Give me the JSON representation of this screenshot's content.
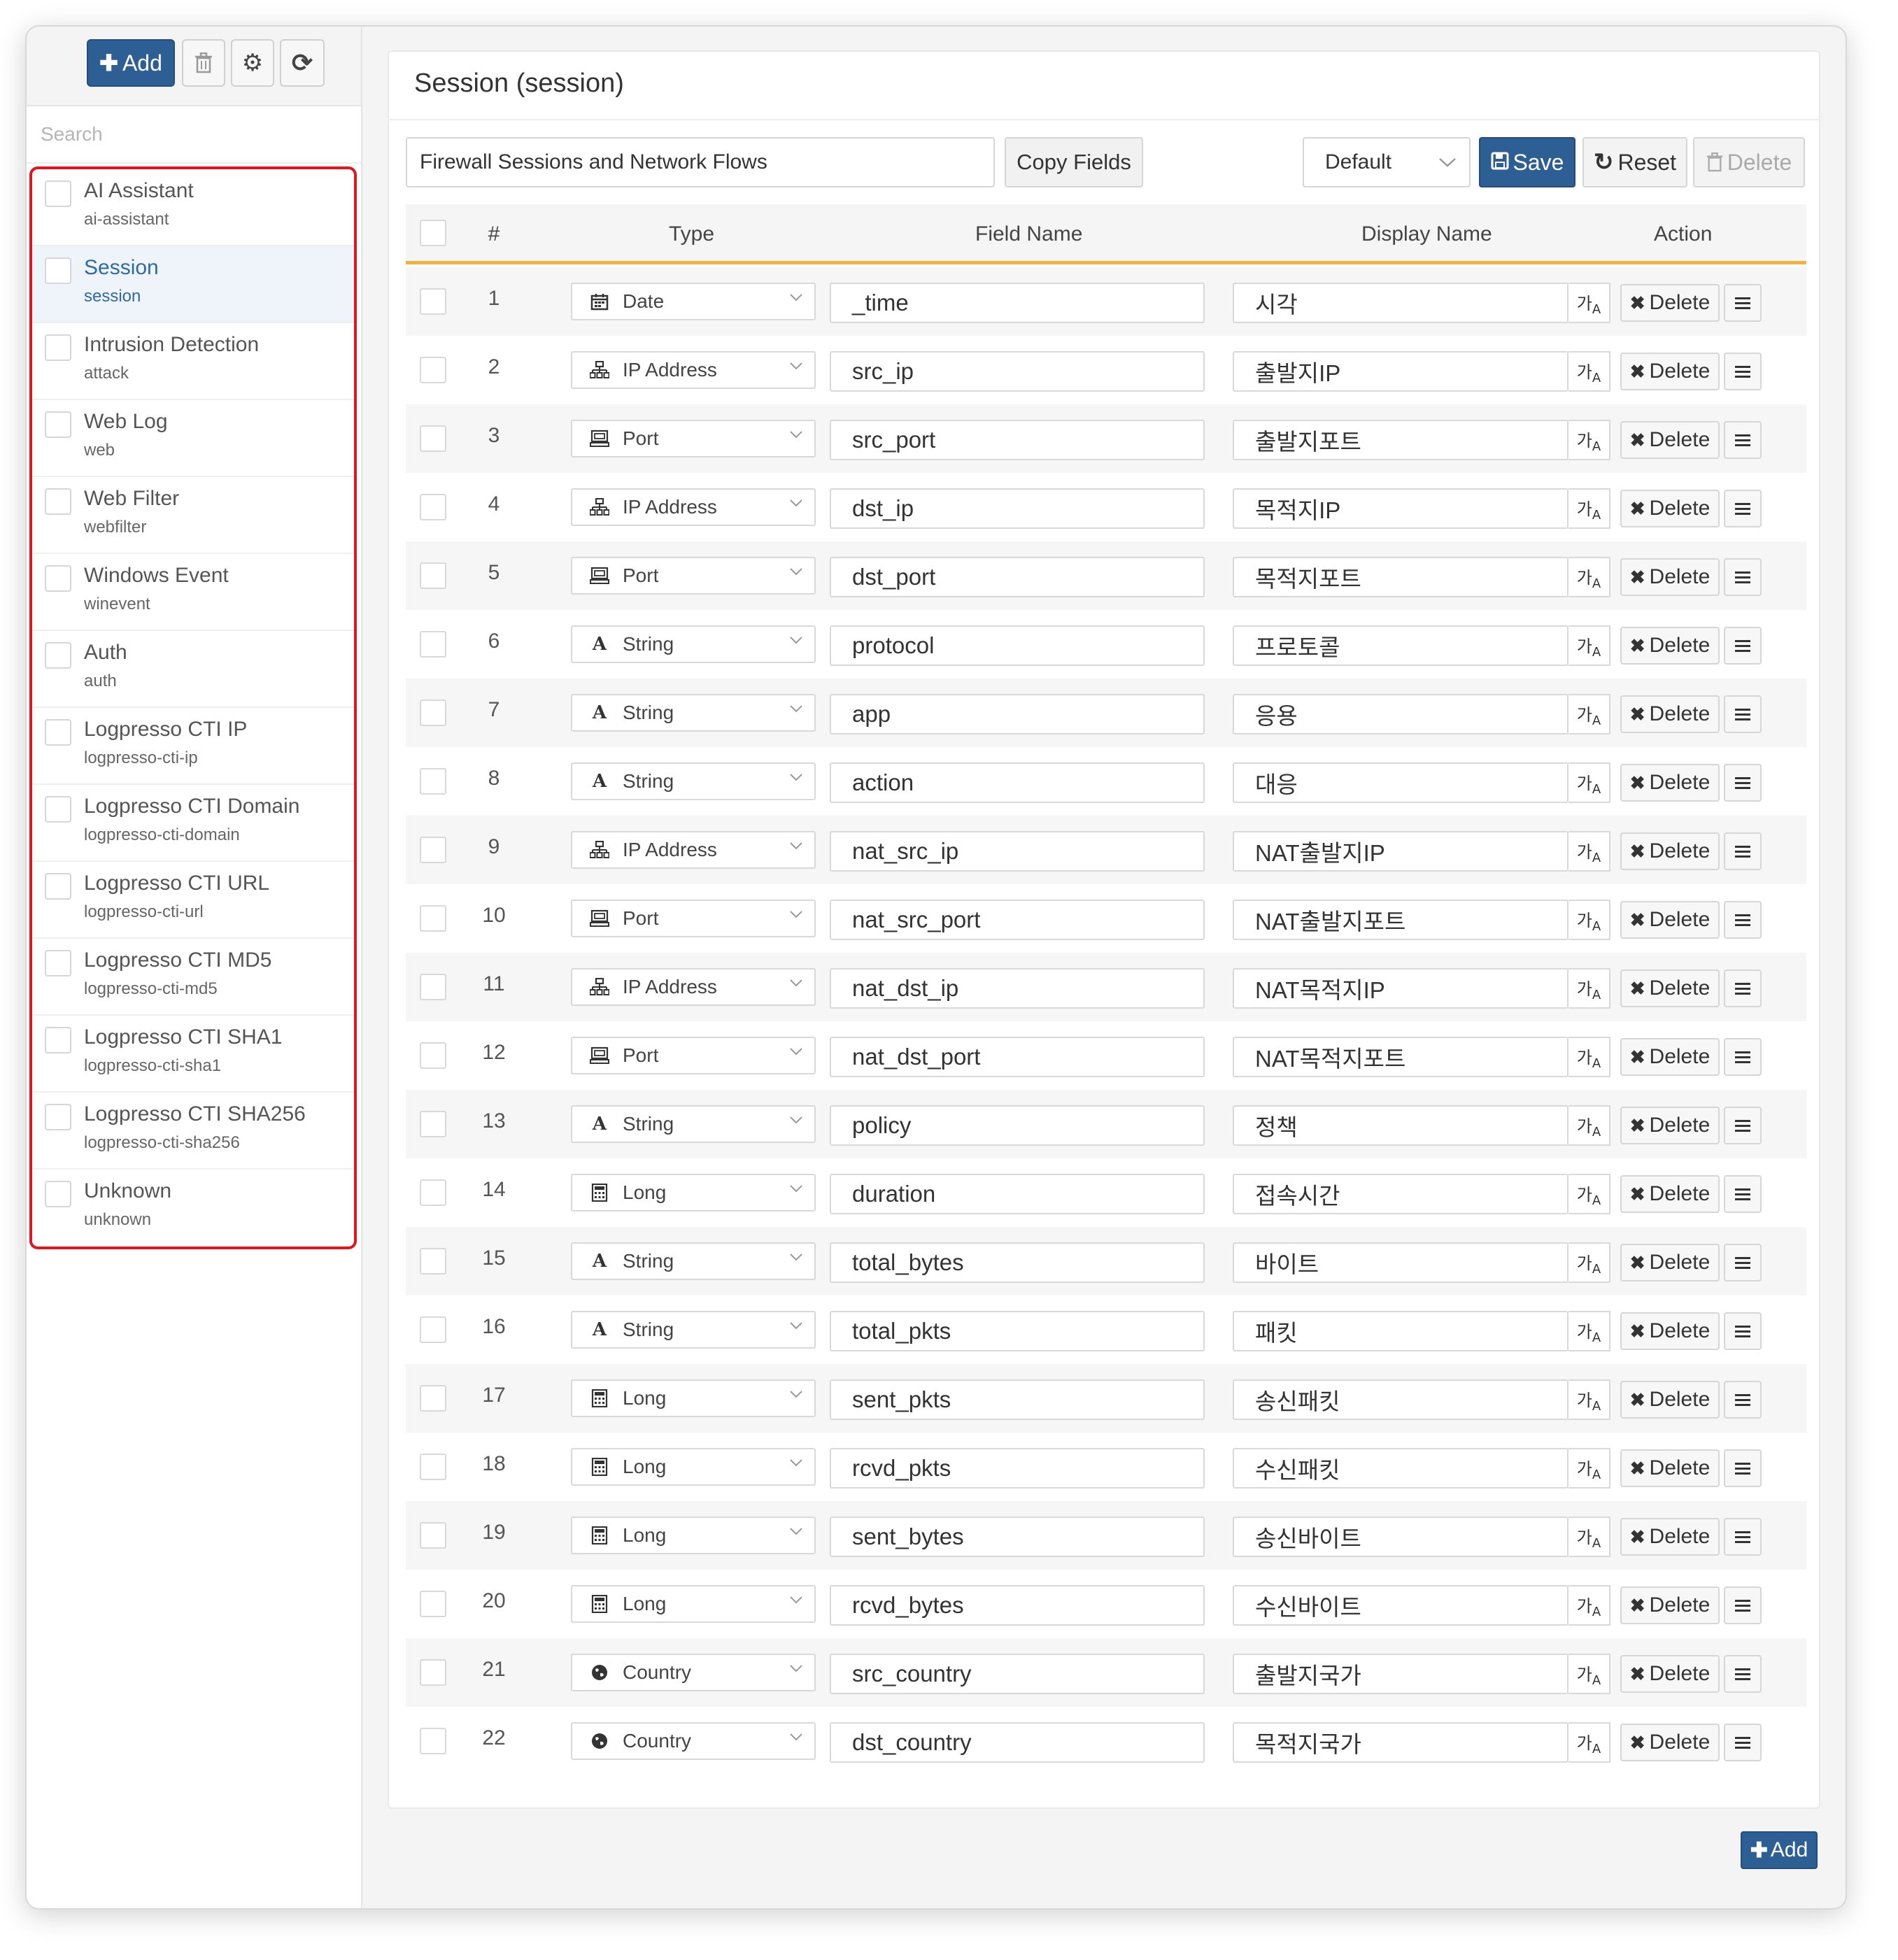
{
  "sidebar": {
    "add_label": "Add",
    "search_placeholder": "Search",
    "categories": [
      {
        "name": "AI Assistant",
        "id": "ai-assistant",
        "selected": false
      },
      {
        "name": "Session",
        "id": "session",
        "selected": true
      },
      {
        "name": "Intrusion Detection",
        "id": "attack",
        "selected": false
      },
      {
        "name": "Web Log",
        "id": "web",
        "selected": false
      },
      {
        "name": "Web Filter",
        "id": "webfilter",
        "selected": false
      },
      {
        "name": "Windows Event",
        "id": "winevent",
        "selected": false
      },
      {
        "name": "Auth",
        "id": "auth",
        "selected": false
      },
      {
        "name": "Logpresso CTI IP",
        "id": "logpresso-cti-ip",
        "selected": false
      },
      {
        "name": "Logpresso CTI Domain",
        "id": "logpresso-cti-domain",
        "selected": false
      },
      {
        "name": "Logpresso CTI URL",
        "id": "logpresso-cti-url",
        "selected": false
      },
      {
        "name": "Logpresso CTI MD5",
        "id": "logpresso-cti-md5",
        "selected": false
      },
      {
        "name": "Logpresso CTI SHA1",
        "id": "logpresso-cti-sha1",
        "selected": false
      },
      {
        "name": "Logpresso CTI SHA256",
        "id": "logpresso-cti-sha256",
        "selected": false
      },
      {
        "name": "Unknown",
        "id": "unknown",
        "selected": false
      }
    ]
  },
  "main": {
    "title": "Session (session)",
    "description": "Firewall Sessions and Network Flows",
    "copy_fields_label": "Copy Fields",
    "profile": "Default",
    "save_label": "Save",
    "reset_label": "Reset",
    "delete_label": "Delete",
    "add_label": "Add",
    "columns": {
      "num": "#",
      "type": "Type",
      "field_name": "Field Name",
      "display_name": "Display Name",
      "action": "Action"
    },
    "row_delete_label": "Delete",
    "rows": [
      {
        "num": "1",
        "type": "Date",
        "icon": "calendar-icon",
        "field": "_time",
        "display": "시각"
      },
      {
        "num": "2",
        "type": "IP Address",
        "icon": "network-icon",
        "field": "src_ip",
        "display": "출발지IP"
      },
      {
        "num": "3",
        "type": "Port",
        "icon": "port-icon",
        "field": "src_port",
        "display": "출발지포트"
      },
      {
        "num": "4",
        "type": "IP Address",
        "icon": "network-icon",
        "field": "dst_ip",
        "display": "목적지IP"
      },
      {
        "num": "5",
        "type": "Port",
        "icon": "port-icon",
        "field": "dst_port",
        "display": "목적지포트"
      },
      {
        "num": "6",
        "type": "String",
        "icon": "font-icon",
        "field": "protocol",
        "display": "프로토콜"
      },
      {
        "num": "7",
        "type": "String",
        "icon": "font-icon",
        "field": "app",
        "display": "응용"
      },
      {
        "num": "8",
        "type": "String",
        "icon": "font-icon",
        "field": "action",
        "display": "대응"
      },
      {
        "num": "9",
        "type": "IP Address",
        "icon": "network-icon",
        "field": "nat_src_ip",
        "display": "NAT출발지IP"
      },
      {
        "num": "10",
        "type": "Port",
        "icon": "port-icon",
        "field": "nat_src_port",
        "display": "NAT출발지포트"
      },
      {
        "num": "11",
        "type": "IP Address",
        "icon": "network-icon",
        "field": "nat_dst_ip",
        "display": "NAT목적지IP"
      },
      {
        "num": "12",
        "type": "Port",
        "icon": "port-icon",
        "field": "nat_dst_port",
        "display": "NAT목적지포트"
      },
      {
        "num": "13",
        "type": "String",
        "icon": "font-icon",
        "field": "policy",
        "display": "정책"
      },
      {
        "num": "14",
        "type": "Long",
        "icon": "calculator-icon",
        "field": "duration",
        "display": "접속시간"
      },
      {
        "num": "15",
        "type": "String",
        "icon": "font-icon",
        "field": "total_bytes",
        "display": "바이트"
      },
      {
        "num": "16",
        "type": "String",
        "icon": "font-icon",
        "field": "total_pkts",
        "display": "패킷"
      },
      {
        "num": "17",
        "type": "Long",
        "icon": "calculator-icon",
        "field": "sent_pkts",
        "display": "송신패킷"
      },
      {
        "num": "18",
        "type": "Long",
        "icon": "calculator-icon",
        "field": "rcvd_pkts",
        "display": "수신패킷"
      },
      {
        "num": "19",
        "type": "Long",
        "icon": "calculator-icon",
        "field": "sent_bytes",
        "display": "송신바이트"
      },
      {
        "num": "20",
        "type": "Long",
        "icon": "calculator-icon",
        "field": "rcvd_bytes",
        "display": "수신바이트"
      },
      {
        "num": "21",
        "type": "Country",
        "icon": "globe-icon",
        "field": "src_country",
        "display": "출발지국가"
      },
      {
        "num": "22",
        "type": "Country",
        "icon": "globe-icon",
        "field": "dst_country",
        "display": "목적지국가"
      }
    ]
  },
  "colors": {
    "primary": "#2d5f94",
    "accent_border": "#f0b33f",
    "highlight_frame": "#e3141b",
    "selected_text": "#2f6aa1"
  }
}
